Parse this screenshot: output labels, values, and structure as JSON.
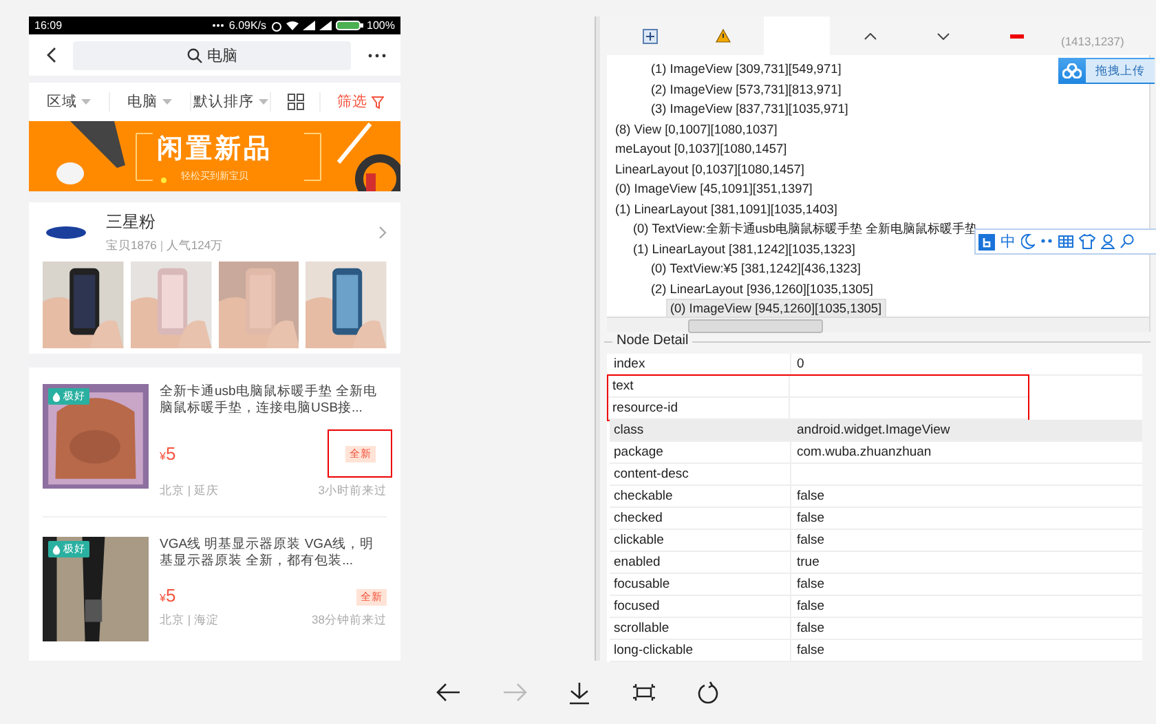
{
  "phone": {
    "status_bar": {
      "time": "16:09",
      "speed": "6.09K/s",
      "battery": "100%"
    },
    "search": {
      "query": "电脑"
    },
    "filters": [
      {
        "kind": "dropdown",
        "label": "区域"
      },
      {
        "kind": "dropdown",
        "label": "电脑"
      },
      {
        "kind": "dropdown",
        "label": "默认排序"
      },
      {
        "kind": "grid"
      },
      {
        "kind": "filter",
        "label": "筛选"
      }
    ],
    "banner": {
      "title": "闲置新品",
      "subtitle": "轻松买到新宝贝"
    },
    "shop": {
      "name": "三星粉",
      "stats": [
        "宝贝1876",
        "人气124万"
      ],
      "photos": [
        {
          "kind": "picture"
        },
        {
          "kind": "picture"
        },
        {
          "kind": "picture"
        },
        {
          "kind": "picture"
        }
      ]
    },
    "products": [
      {
        "badge": "极好",
        "title": "全新卡通usb电脑鼠标暖手垫 全新电脑鼠标暖手垫，连接电脑USB接...",
        "currency": "¥",
        "price": "5",
        "tag": "全新",
        "highlighted": true,
        "location": "北京 | 延庆",
        "time": "3小时前来过"
      },
      {
        "badge": "极好",
        "title": "VGA线 明基显示器原装 VGA线，明基显示器原装 全新，都有包装...",
        "currency": "¥",
        "price": "5",
        "tag": "全新",
        "highlighted": false,
        "location": "北京 | 海淀",
        "time": "38分钟前来过"
      }
    ]
  },
  "inspector": {
    "toolbar": [
      {
        "kind": "expand"
      },
      {
        "kind": "warning"
      },
      {
        "kind": "blank"
      },
      {
        "kind": "up"
      },
      {
        "kind": "down"
      },
      {
        "kind": "minus"
      }
    ],
    "coords": "(1413,1237)",
    "tree": [
      {
        "children": [
          {
            "children": [
              {
                "text": "(1) ImageView [309,731][549,971]",
                "selected": false
              },
              {
                "text": "(2) ImageView [573,731][813,971]",
                "selected": false
              },
              {
                "text": "(3) ImageView [837,731][1035,971]",
                "selected": false
              }
            ]
          }
        ]
      },
      {
        "text": "(8) View [0,1007][1080,1037]",
        "selected": false
      },
      {
        "text": "meLayout [0,1037][1080,1457]",
        "selected": false
      },
      {
        "text": "LinearLayout [0,1037][1080,1457]",
        "selected": false
      },
      {
        "text": "(0) ImageView [45,1091][351,1397]",
        "selected": false
      },
      {
        "text": "(1) LinearLayout [381,1091][1035,1403]",
        "selected": false,
        "children": [
          {
            "text": "(0) TextView:全新卡通usb电脑鼠标暖手垫 全新电脑鼠标暖手垫",
            "selected": false
          },
          {
            "text": "(1) LinearLayout [381,1242][1035,1323]",
            "selected": false,
            "children": [
              {
                "text": "(0) TextView:¥5 [381,1242][436,1323]",
                "selected": false
              },
              {
                "text": "(2) LinearLayout [936,1260][1035,1305]",
                "selected": false,
                "children": [
                  {
                    "text": "(0) ImageView [945,1260][1035,1305]",
                    "selected": true
                  }
                ]
              }
            ]
          }
        ]
      }
    ],
    "upload_button": {
      "label": "拖拽上传"
    },
    "ime": {
      "mode": "中"
    },
    "node_detail": {
      "title": "Node Detail",
      "rows": [
        {
          "key": "index",
          "value": "0",
          "highlighted": false,
          "selected": false
        },
        {
          "key": "text",
          "highlighted": true,
          "selected": false
        },
        {
          "key": "resource-id",
          "highlighted": true,
          "selected": false
        },
        {
          "key": "class",
          "value": "android.widget.ImageView",
          "highlighted": false,
          "selected": true
        },
        {
          "key": "package",
          "value": "com.wuba.zhuanzhuan",
          "highlighted": false,
          "selected": false
        },
        {
          "key": "content-desc",
          "highlighted": false,
          "selected": false
        },
        {
          "key": "checkable",
          "value": "false",
          "highlighted": false,
          "selected": false
        },
        {
          "key": "checked",
          "value": "false",
          "highlighted": false,
          "selected": false
        },
        {
          "key": "clickable",
          "value": "false",
          "highlighted": false,
          "selected": false
        },
        {
          "key": "enabled",
          "value": "true",
          "highlighted": false,
          "selected": false
        },
        {
          "key": "focusable",
          "value": "false",
          "highlighted": false,
          "selected": false
        },
        {
          "key": "focused",
          "value": "false",
          "highlighted": false,
          "selected": false
        },
        {
          "key": "scrollable",
          "value": "false",
          "highlighted": false,
          "selected": false
        },
        {
          "key": "long-clickable",
          "value": "false",
          "highlighted": false,
          "selected": false
        }
      ]
    }
  },
  "nav": [
    {
      "kind": "back",
      "disabled": false
    },
    {
      "kind": "forward",
      "disabled": true
    },
    {
      "kind": "download",
      "disabled": false
    },
    {
      "kind": "capture",
      "disabled": false
    },
    {
      "kind": "refresh",
      "disabled": false
    }
  ]
}
